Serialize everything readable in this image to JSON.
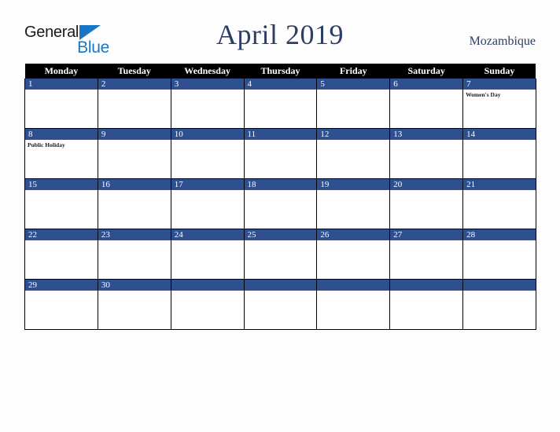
{
  "brand": {
    "name_part1": "General",
    "name_part2": "Blue",
    "triangle_icon": "triangle-icon",
    "accent_color": "#1976c5"
  },
  "header": {
    "title": "April 2019",
    "country": "Mozambique",
    "title_color": "#2c3e63"
  },
  "calendar": {
    "month": "April",
    "year": "2019",
    "weekdays": [
      "Monday",
      "Tuesday",
      "Wednesday",
      "Thursday",
      "Friday",
      "Saturday",
      "Sunday"
    ],
    "header_bg": "#000000",
    "date_band_color": "#2e5090",
    "weeks": [
      [
        {
          "date": "1",
          "events": []
        },
        {
          "date": "2",
          "events": []
        },
        {
          "date": "3",
          "events": []
        },
        {
          "date": "4",
          "events": []
        },
        {
          "date": "5",
          "events": []
        },
        {
          "date": "6",
          "events": []
        },
        {
          "date": "7",
          "events": [
            "Women's Day"
          ]
        }
      ],
      [
        {
          "date": "8",
          "events": [
            "Public Holiday"
          ]
        },
        {
          "date": "9",
          "events": []
        },
        {
          "date": "10",
          "events": []
        },
        {
          "date": "11",
          "events": []
        },
        {
          "date": "12",
          "events": []
        },
        {
          "date": "13",
          "events": []
        },
        {
          "date": "14",
          "events": []
        }
      ],
      [
        {
          "date": "15",
          "events": []
        },
        {
          "date": "16",
          "events": []
        },
        {
          "date": "17",
          "events": []
        },
        {
          "date": "18",
          "events": []
        },
        {
          "date": "19",
          "events": []
        },
        {
          "date": "20",
          "events": []
        },
        {
          "date": "21",
          "events": []
        }
      ],
      [
        {
          "date": "22",
          "events": []
        },
        {
          "date": "23",
          "events": []
        },
        {
          "date": "24",
          "events": []
        },
        {
          "date": "25",
          "events": []
        },
        {
          "date": "26",
          "events": []
        },
        {
          "date": "27",
          "events": []
        },
        {
          "date": "28",
          "events": []
        }
      ],
      [
        {
          "date": "29",
          "events": []
        },
        {
          "date": "30",
          "events": []
        },
        {
          "date": "",
          "events": []
        },
        {
          "date": "",
          "events": []
        },
        {
          "date": "",
          "events": []
        },
        {
          "date": "",
          "events": []
        },
        {
          "date": "",
          "events": []
        }
      ]
    ]
  }
}
